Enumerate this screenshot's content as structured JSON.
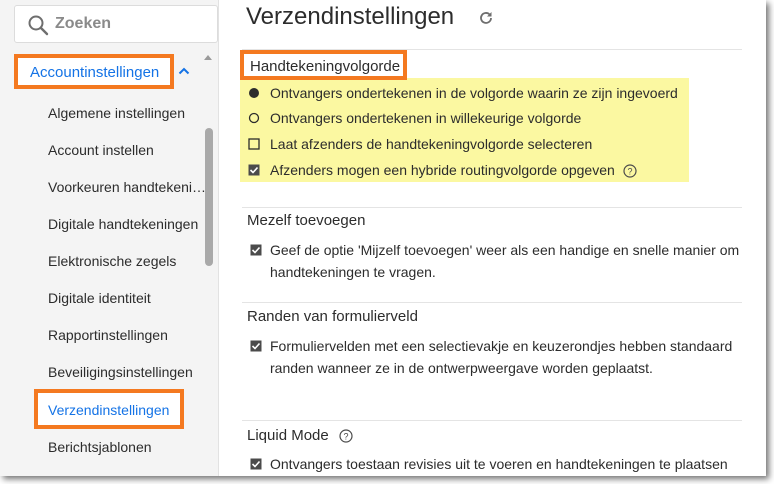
{
  "search": {
    "placeholder": "Zoeken"
  },
  "sidebar": {
    "section_label": "Accountinstellingen",
    "items": [
      {
        "label": "Algemene instellingen"
      },
      {
        "label": "Account instellen"
      },
      {
        "label": "Voorkeuren handtekeningen"
      },
      {
        "label": "Digitale handtekeningen"
      },
      {
        "label": "Elektronische zegels"
      },
      {
        "label": "Digitale identiteit"
      },
      {
        "label": "Rapportinstellingen"
      },
      {
        "label": "Beveiligingsinstellingen"
      },
      {
        "label": "Verzendinstellingen"
      },
      {
        "label": "Berichtsjablonen"
      }
    ]
  },
  "main": {
    "title": "Verzendinstellingen",
    "signing_order": {
      "title": "Handtekeningvolgorde",
      "options": [
        {
          "label": "Ontvangers ondertekenen in de volgorde waarin ze zijn ingevoerd",
          "selected": true
        },
        {
          "label": "Ontvangers ondertekenen in willekeurige volgorde",
          "selected": false
        }
      ],
      "checkboxes": [
        {
          "label": "Laat afzenders de handtekeningvolgorde selecteren",
          "checked": false
        },
        {
          "label": "Afzenders mogen een hybride routingvolgorde opgeven",
          "checked": true
        }
      ]
    },
    "add_myself": {
      "title": "Mezelf toevoegen",
      "line1": "Geef de optie 'Mijzelf toevoegen' weer als een handige en snelle manier om",
      "line2": "handtekeningen te vragen.",
      "checked": true
    },
    "form_borders": {
      "title": "Randen van formulierveld",
      "line1": "Formuliervelden met een selectievakje en keuzerondjes hebben standaard",
      "line2": "randen wanneer ze in de ontwerpweergave worden geplaatst.",
      "checked": true
    },
    "liquid_mode": {
      "title": "Liquid Mode",
      "line1": "Ontvangers toestaan revisies uit te voeren en handtekeningen te plaatsen in",
      "checked": true
    }
  },
  "colors": {
    "accent": "#1473e6",
    "highlight_border": "#f47920",
    "highlight_fill": "#fbf8a1"
  }
}
